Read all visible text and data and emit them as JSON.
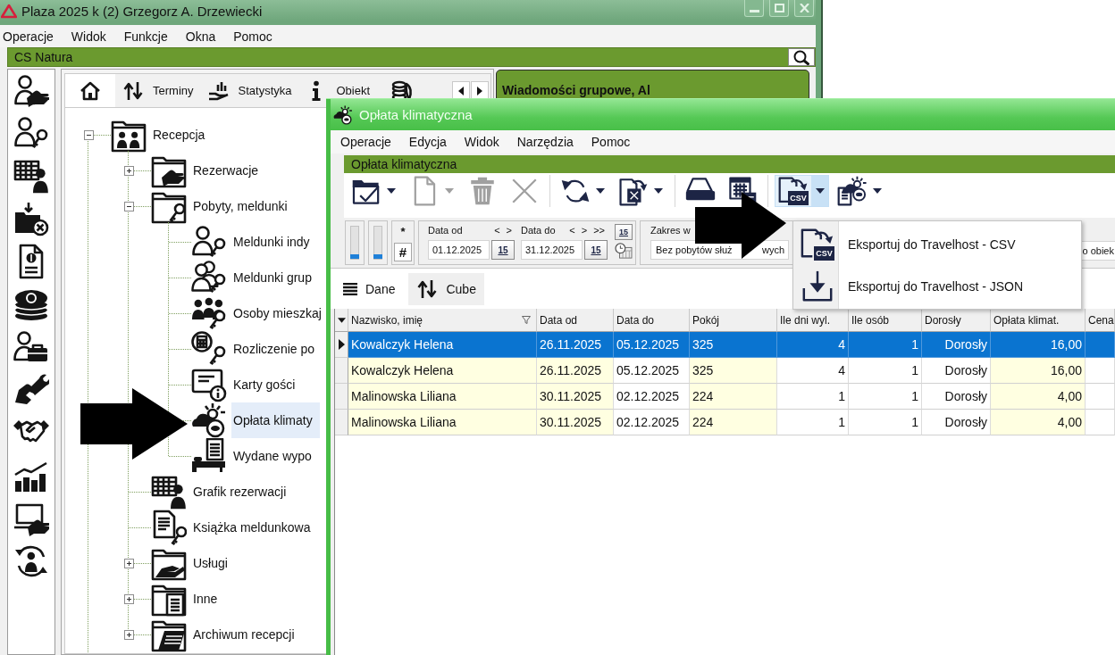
{
  "main_window": {
    "title": "Plaza 2025 k (2) Grzegorz A. Drzewiecki",
    "menu": [
      "Operacje",
      "Widok",
      "Funkcje",
      "Okna",
      "Pomoc"
    ],
    "location_bar": {
      "title": "CS Natura"
    },
    "tabs": [
      {
        "selected": true
      },
      {
        "label": "Terminy",
        "selected": false
      },
      {
        "label": "Statystyka",
        "selected": false
      },
      {
        "label": "Obiekt",
        "selected": false
      },
      {
        "selected": false
      }
    ],
    "tree": [
      {
        "label": "Recepcja",
        "kind": "folder",
        "expanded": true,
        "selected": false,
        "children": [
          {
            "label": "Rezerwacje",
            "kind": "folder",
            "expanded": false,
            "selected": false
          },
          {
            "label": "Pobyty, meldunki",
            "kind": "folder",
            "expanded": true,
            "selected": false,
            "children": [
              {
                "label": "Meldunki indy",
                "kind": "item",
                "selected": false
              },
              {
                "label": "Meldunki grup",
                "kind": "item",
                "selected": false
              },
              {
                "label": "Osoby mieszkaj",
                "kind": "item",
                "selected": false
              },
              {
                "label": "Rozliczenie po",
                "kind": "item",
                "selected": false
              },
              {
                "label": "Karty gości",
                "kind": "item",
                "selected": false
              },
              {
                "label": "Opłata klimaty",
                "kind": "item",
                "selected": true
              },
              {
                "label": "Wydane wypo",
                "kind": "item",
                "selected": false
              }
            ]
          },
          {
            "label": "Grafik rezerwacji",
            "kind": "item",
            "selected": false
          },
          {
            "label": "Książka meldunkowa",
            "kind": "item",
            "selected": false
          },
          {
            "label": "Usługi",
            "kind": "folder",
            "expanded": false,
            "selected": false
          },
          {
            "label": "Inne",
            "kind": "folder",
            "expanded": false,
            "selected": false
          },
          {
            "label": "Archiwum recepcji",
            "kind": "folder",
            "expanded": false,
            "selected": false
          }
        ]
      }
    ],
    "messages_panel": {
      "title": "Wiadomości grupowe, Al"
    }
  },
  "child_window": {
    "title": "Opłata klimatyczna",
    "menu": [
      "Operacje",
      "Edycja",
      "Widok",
      "Narzędzia",
      "Pomoc"
    ],
    "header": "Opłata klimatyczna",
    "toolbar": [
      [
        {
          "dropdown": true,
          "disabled": false,
          "expanded": false
        },
        {
          "dropdown": true,
          "disabled": true,
          "expanded": false
        },
        {
          "dropdown": false,
          "disabled": true,
          "expanded": false
        },
        {
          "dropdown": false,
          "disabled": true,
          "expanded": false
        }
      ],
      [
        {
          "dropdown": true,
          "disabled": false,
          "expanded": false
        },
        {
          "dropdown": true,
          "disabled": false,
          "expanded": false
        }
      ],
      [
        {
          "dropdown": false,
          "disabled": false,
          "expanded": false
        },
        {
          "dropdown": false,
          "disabled": false,
          "expanded": false
        }
      ],
      [
        {
          "dropdown": true,
          "disabled": false,
          "expanded": true,
          "badge": "CSV",
          "menu": [
            {
              "label": "Eksportuj do Travelhost - CSV",
              "badge": "CSV"
            },
            {
              "label": "Eksportuj do Travelhost - JSON"
            }
          ]
        },
        {
          "dropdown": true,
          "disabled": false,
          "expanded": false
        }
      ]
    ],
    "filters": {
      "sliders": [
        {
          "level": 0
        },
        {
          "level": 0
        }
      ],
      "mode_buttons": [
        {
          "label": "*",
          "selected": false
        },
        {
          "label": "#",
          "selected": true
        }
      ],
      "date_from": {
        "label": "Data od",
        "nav": [
          "<",
          ">"
        ],
        "value": "01.12.2025",
        "picker": "15"
      },
      "date_to": {
        "label": "Data do",
        "nav": [
          "<",
          ">",
          ">>"
        ],
        "value": "31.12.2025",
        "picker": "15"
      },
      "calendar_button": "15",
      "range": {
        "label": "Zakres w",
        "value_start": "Bez pobytów służ",
        "value_end": "wych"
      },
      "partial_field": {
        "value": "o obiek"
      }
    },
    "view_tabs": [
      {
        "label": "Dane",
        "selected": true
      },
      {
        "label": "Cube",
        "selected": false
      }
    ],
    "table": {
      "columns": [
        {
          "label": "Nazwisko, imię",
          "kind": "text",
          "shaded": true,
          "filter": true
        },
        {
          "label": "Data od",
          "kind": "date",
          "shaded": true,
          "filter": false
        },
        {
          "label": "Data do",
          "kind": "date",
          "shaded": false,
          "filter": false
        },
        {
          "label": "Pokój",
          "kind": "text",
          "shaded": true,
          "filter": false
        },
        {
          "label": "Ile dni wyl.",
          "kind": "number",
          "shaded": false,
          "filter": false
        },
        {
          "label": "Ile osób",
          "kind": "number",
          "shaded": false,
          "filter": false
        },
        {
          "label": "Dorosły",
          "kind": "category",
          "shaded": false,
          "filter": false
        },
        {
          "label": "Opłata klimat.",
          "kind": "number",
          "shaded": true,
          "filter": false
        },
        {
          "label": "Cena",
          "kind": "number",
          "shaded": false,
          "filter": false
        }
      ],
      "rows": [
        {
          "selected": true,
          "cells": [
            "Kowalczyk Helena",
            "26.11.2025",
            "05.12.2025",
            "325",
            "4",
            "1",
            "Dorosły",
            "16,00"
          ]
        },
        {
          "selected": false,
          "cells": [
            "Kowalczyk Helena",
            "26.11.2025",
            "05.12.2025",
            "325",
            "4",
            "1",
            "Dorosły",
            "16,00"
          ]
        },
        {
          "selected": false,
          "cells": [
            "Malinowska Liliana",
            "30.11.2025",
            "02.12.2025",
            "224",
            "1",
            "1",
            "Dorosły",
            "4,00"
          ]
        },
        {
          "selected": false,
          "cells": [
            "Malinowska Liliana",
            "30.11.2025",
            "02.12.2025",
            "224",
            "1",
            "1",
            "Dorosły",
            "4,00"
          ]
        }
      ]
    }
  }
}
